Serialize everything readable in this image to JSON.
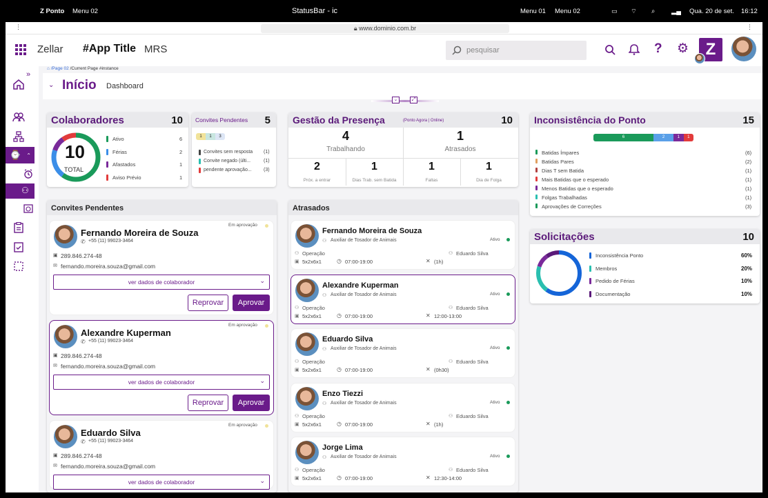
{
  "macbar": {
    "app": "Z Ponto",
    "menu_left": "Menu 02",
    "center": "StatusBar - ic",
    "menu_r1": "Menu 01",
    "menu_r2": "Menu 02",
    "date": "Qua. 20 de set.",
    "time": "16:12"
  },
  "browser": {
    "url": "www.dominio.com.br"
  },
  "topnav": {
    "brand": "Zellar",
    "app_title": "#App Title",
    "module": "MRS",
    "search_placeholder": "pesquisar",
    "logo_letter": "Z"
  },
  "breadcrumb": {
    "page": "/Page 02",
    "current": "/Current Page",
    "instance": "#instance"
  },
  "header": {
    "title": "Início",
    "subtitle": "Dashboard"
  },
  "colaboradores": {
    "title": "Colaboradores",
    "count": "10",
    "total": "10",
    "total_label": "TOTAL",
    "items": [
      {
        "label": "Ativo",
        "value": "6",
        "color": "#1a9a5a"
      },
      {
        "label": "Férias",
        "value": "2",
        "color": "#3b8ee8"
      },
      {
        "label": "Afastados",
        "value": "1",
        "color": "#7a2a9a"
      },
      {
        "label": "Aviso Prévio",
        "value": "1",
        "color": "#e23b3b"
      }
    ]
  },
  "convites_mini": {
    "title": "Convites Pendentes",
    "count": "5",
    "seg": [
      "1",
      "1",
      "3"
    ],
    "items": [
      {
        "label": "Convites sem resposta",
        "value": "(1)",
        "color": "#444"
      },
      {
        "label": "Convite negado (últi...",
        "value": "(1)",
        "color": "#2abfb0"
      },
      {
        "label": "pendente aprovação...",
        "value": "(3)",
        "color": "#e23b3b"
      }
    ]
  },
  "presenca": {
    "title": "Gestão da Presença",
    "tag": "(Ponto Agora | Online)",
    "count": "10",
    "top": [
      {
        "value": "4",
        "label": "Trabalhando"
      },
      {
        "value": "1",
        "label": "Atrasados"
      }
    ],
    "bottom": [
      {
        "value": "2",
        "label": "Próx. a entrar"
      },
      {
        "value": "1",
        "label": "Dias Trab. sem Batida"
      },
      {
        "value": "1",
        "label": "Faltas"
      },
      {
        "value": "1",
        "label": "Dia de Folga"
      }
    ]
  },
  "inconsistencia": {
    "title": "Inconsistência do Ponto",
    "count": "15",
    "bar": [
      "6",
      "2",
      "1",
      "1"
    ],
    "items": [
      {
        "label": "Batidas Ímpares",
        "value": "(6)",
        "color": "#1a9a5a"
      },
      {
        "label": "Batidas Pares",
        "value": "(2)",
        "color": "#e0a060"
      },
      {
        "label": "Dias T sem Batida",
        "value": "(1)",
        "color": "#b04040"
      },
      {
        "label": "Mais Batidas que o esperado",
        "value": "(1)",
        "color": "#e23b3b"
      },
      {
        "label": "Menos Batidas que o esperado",
        "value": "(1)",
        "color": "#7a2a9a"
      },
      {
        "label": "Folgas Trabalhadas",
        "value": "(1)",
        "color": "#2abfb0"
      },
      {
        "label": "Aprovações de Correções",
        "value": "(3)",
        "color": "#1a9a5a"
      }
    ]
  },
  "solicitacoes": {
    "title": "Solicitações",
    "count": "10",
    "items": [
      {
        "label": "Inconsistência Ponto",
        "value": "60%",
        "color": "#1565d8"
      },
      {
        "label": "Membros",
        "value": "20%",
        "color": "#2abfb0"
      },
      {
        "label": "Pedido de Férias",
        "value": "10%",
        "color": "#7a2a9a"
      },
      {
        "label": "Documentação",
        "value": "10%",
        "color": "#5b1a7a"
      }
    ]
  },
  "convites": {
    "title": "Convites Pendentes",
    "status": "Em aprovação",
    "select_label": "ver dados de colaborador",
    "reject": "Reprovar",
    "approve": "Aprovar",
    "people": [
      {
        "name": "Fernando Moreira de Souza",
        "phone": "+55 (11) 99023-3464",
        "doc": "289.846.274-48",
        "email": "fernando.moreira.souza@gmail.com"
      },
      {
        "name": "Alexandre Kuperman",
        "phone": "+55 (11) 99023-3464",
        "doc": "289.846.274-48",
        "email": "fernando.moreira.souza@gmail.com"
      },
      {
        "name": "Eduardo Silva",
        "phone": "+55 (11) 99023-3464",
        "doc": "289.846.274-48",
        "email": "fernando.moreira.souza@gmail.com"
      }
    ]
  },
  "atrasados": {
    "title": "Atrasados",
    "role": "Auxiliar de Tosador de Animais",
    "status": "Ativo",
    "sector": "Operação",
    "manager": "Eduardo Silva",
    "hours": "07:00-19:00",
    "people": [
      {
        "name": "Fernando Moreira de Souza",
        "shift": "5x2x6x1",
        "break": "(1h)"
      },
      {
        "name": "Alexandre Kuperman",
        "shift": "5x2x6x1",
        "break": "12:00-13:00"
      },
      {
        "name": "Eduardo Silva",
        "shift": "5x2x6x1",
        "break": "(0h30)"
      },
      {
        "name": "Enzo Tiezzi",
        "shift": "5x2x6x1",
        "break": "(1h)"
      },
      {
        "name": "Jorge Lima",
        "shift": "5x2x6x1",
        "break": "12:30-14:00"
      }
    ]
  }
}
